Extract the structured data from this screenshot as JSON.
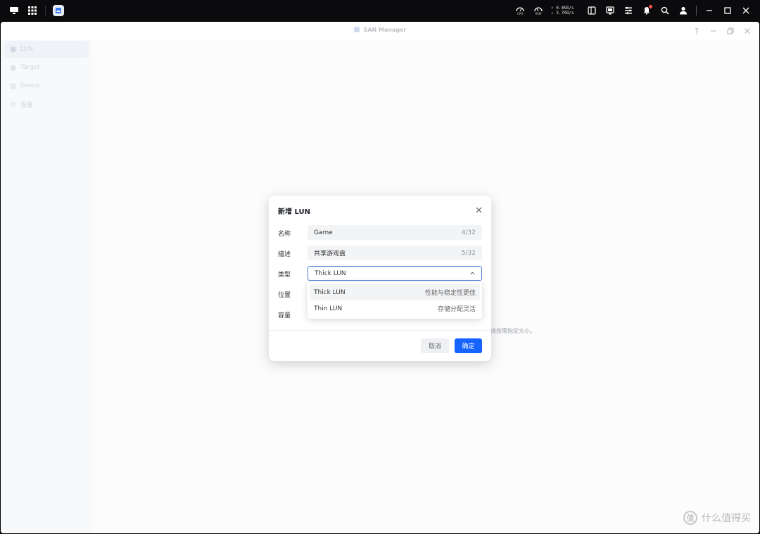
{
  "taskbar": {
    "gauges": [
      {
        "label": "CPU"
      },
      {
        "label": "RAM"
      }
    ],
    "net_up": "↑ 0.4KB/s",
    "net_down": "↓ 3.7KB/s"
  },
  "window": {
    "title": "SAN Manager",
    "help_icon": "?"
  },
  "sidebar": {
    "items": [
      {
        "label": "LUN",
        "icon": "database-icon"
      },
      {
        "label": "Target",
        "icon": "target-icon"
      },
      {
        "label": "Group",
        "icon": "list-icon"
      },
      {
        "label": "设置",
        "icon": "gear-icon"
      }
    ]
  },
  "dialog": {
    "title": "新增 LUN",
    "name_label": "名称",
    "name_value": "Game",
    "name_count": "4/32",
    "desc_label": "描述",
    "desc_value": "共享游戏盘",
    "desc_count": "5/32",
    "type_label": "类型",
    "type_value": "Thick LUN",
    "location_label": "位置",
    "capacity_label": "容量",
    "hint_fragment": "请按需指定大小。",
    "options": [
      {
        "label": "Thick LUN",
        "desc": "性能与稳定性更佳"
      },
      {
        "label": "Thin LUN",
        "desc": "存储分配灵活"
      }
    ],
    "cancel_label": "取消",
    "ok_label": "确定"
  },
  "watermark": {
    "badge": "值",
    "text": "什么值得买"
  },
  "colors": {
    "primary": "#1664ff",
    "select_border": "#4a7bd8"
  }
}
